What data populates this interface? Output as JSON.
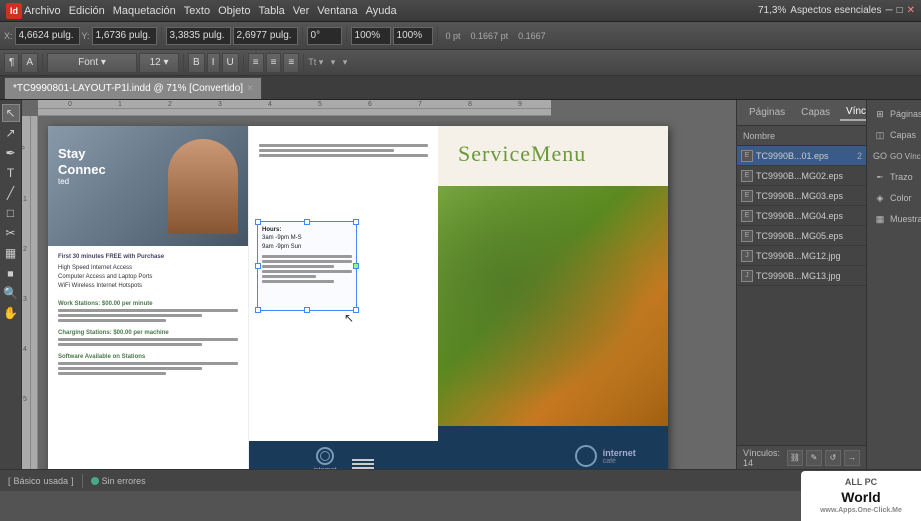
{
  "app": {
    "icon": "Id",
    "menu": [
      "Archivo",
      "Edición",
      "Maquetación",
      "Texto",
      "Objeto",
      "Tabla",
      "Ver",
      "Ventana",
      "Ayuda"
    ],
    "zoom": "71,3%",
    "workspace": "Aspectos esenciales"
  },
  "toolbar": {
    "x_label": "X:",
    "x_value": "4,6624 pulg.",
    "y_label": "Y:",
    "y_value": "1,6736 pulg.",
    "w_label": "X:",
    "w_value": "3,3835 pulg.",
    "h_value": "2,6977 pulg.",
    "angle": "0°",
    "scale_x": "100%",
    "scale_y": "100%"
  },
  "tab": {
    "filename": "*TC9990801-LAYOUT-P1l.indd @ 71% [Convertido]",
    "close": "×"
  },
  "links_panel": {
    "tab1": "Páginas",
    "tab2": "Capas",
    "tab3": "Vínculos",
    "header_name": "Nombre",
    "header_num": "",
    "items": [
      {
        "name": "TC9990B...01.eps",
        "num": "2",
        "selected": true
      },
      {
        "name": "TC9990B...MG02.eps",
        "num": ""
      },
      {
        "name": "TC9990B...MG03.eps",
        "num": ""
      },
      {
        "name": "TC9990B...MG04.eps",
        "num": ""
      },
      {
        "name": "TC9990B...MG05.eps",
        "num": ""
      },
      {
        "name": "TC9990B...MG12.jpg",
        "num": ""
      },
      {
        "name": "TC9990B...MG13.jpg",
        "num": ""
      }
    ],
    "footer_label": "Vínculos: 14"
  },
  "far_right": {
    "items": [
      "Páginas",
      "Capas",
      "GO Vínculos",
      "Trazo",
      "Color",
      "Muestras"
    ]
  },
  "brochure": {
    "left": {
      "headline1": "Stay",
      "headline2": "Connec",
      "promo_title": "First 30 minutes FREE with Purchase",
      "promo_items": [
        "High Speed Internet Access",
        "Computer Access and Laptop Ports",
        "WiFi Wireless Internet Hotspots"
      ],
      "section1": "Work Stations: $00.00 per minute",
      "section2": "Charging Stations: $00.00 per machine",
      "section3": "Software Available on Stations"
    },
    "right": {
      "title": "ServiceMenu"
    },
    "text_box": {
      "line1": "Hours:",
      "line2": "3am -9pm M-S",
      "line3": "9am -9pm Sun"
    }
  },
  "status_bar": {
    "style": "Básico",
    "mode": "usada",
    "errors": "Sin errores"
  },
  "watermark": {
    "top": "ALL PC",
    "main": "World",
    "sub": "www.Apps.One-Click.Me"
  }
}
